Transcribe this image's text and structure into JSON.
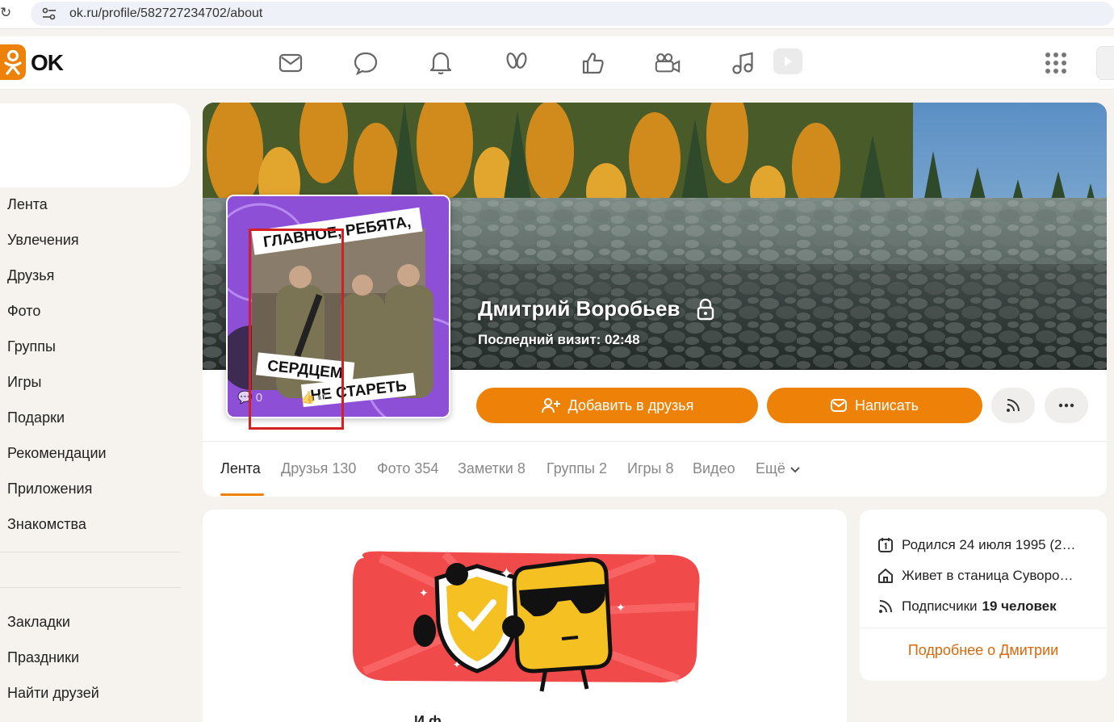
{
  "browser": {
    "url": "ok.ru/profile/582727234702/about"
  },
  "header": {
    "logo_text": "OK",
    "icons": [
      "mail-icon",
      "chat-icon",
      "bell-icon",
      "guests-icon",
      "like-icon",
      "video-camera-icon",
      "music-icon",
      "video-icon",
      "apps-grid-icon"
    ]
  },
  "sidebar": {
    "items": [
      "Лента",
      "Увлечения",
      "Друзья",
      "Фото",
      "Группы",
      "Игры",
      "Подарки",
      "Рекомендации",
      "Приложения",
      "Знакомства"
    ],
    "secondary_items": [
      "Закладки",
      "Праздники",
      "Найти друзей"
    ]
  },
  "profile": {
    "name": "Дмитрий Воробьев",
    "last_visit": "Последний визит: 02:48",
    "avatar_text_top": "ГЛАВНОЕ, РЕБЯТА,",
    "avatar_text_bottom_1": "СЕРДЦЕМ",
    "avatar_text_bottom_2": "НЕ СТАРЕТЬ",
    "avatar_comments": "0",
    "avatar_likes": "0",
    "add_friend_label": "Добавить в друзья",
    "write_label": "Написать"
  },
  "tabs": [
    "Лента",
    "Друзья 130",
    "Фото 354",
    "Заметки 8",
    "Группы 2",
    "Игры 8",
    "Видео",
    "Ещё"
  ],
  "info": {
    "born": "Родился 24 июля 1995 (2…",
    "lives": "Живет в станица Суворо…",
    "subscribers_label": "Подписчики",
    "subscribers_value": "19 человек",
    "more_link": "Подробнее о Дмитрии"
  },
  "feed": {
    "partial_heading": "И  ф"
  },
  "colors": {
    "accent": "#ee8208",
    "page_bg": "#f6f3ef",
    "link": "#d9680a"
  }
}
